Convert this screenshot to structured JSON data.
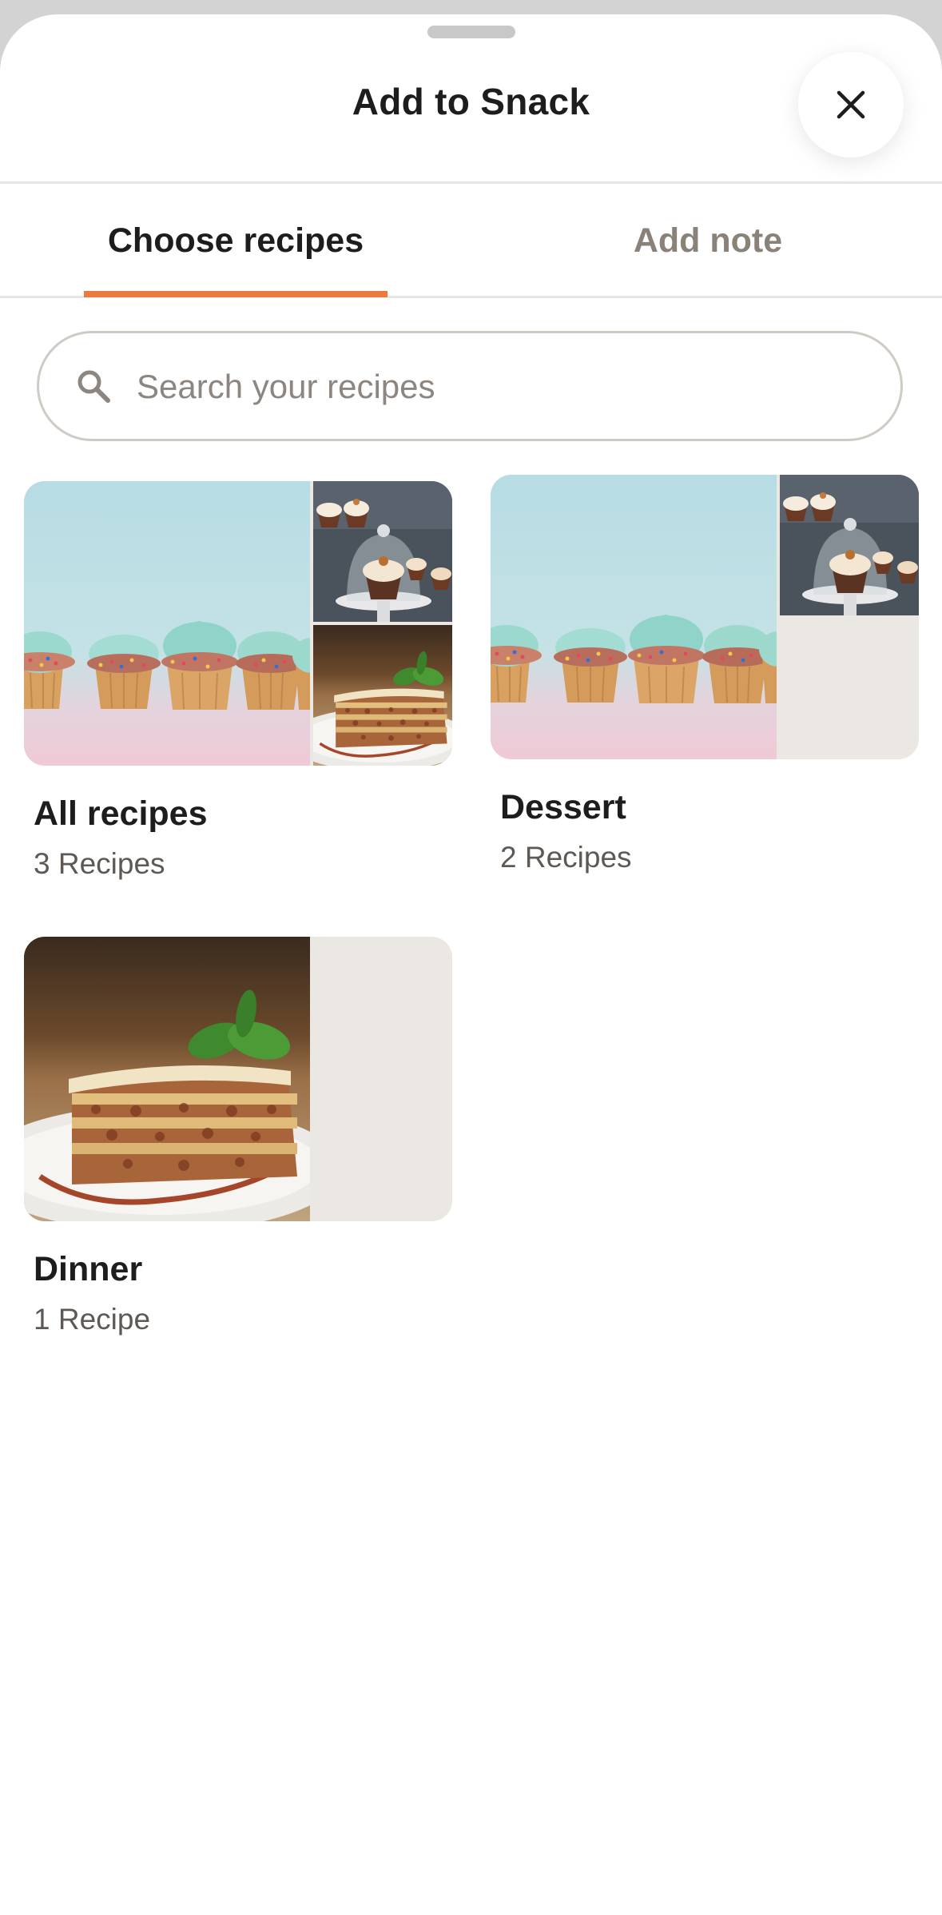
{
  "sheet": {
    "title": "Add to Snack",
    "close_icon": "close-icon"
  },
  "tabs": [
    {
      "label": "Choose recipes",
      "active": true
    },
    {
      "label": "Add note",
      "active": false
    }
  ],
  "colors": {
    "accent": "#ea7a3d",
    "text_primary": "#1d1d1d",
    "text_muted": "#8a8178",
    "placeholder_tile": "#ebe8e3"
  },
  "search": {
    "placeholder": "Search your recipes",
    "value": "",
    "icon": "search-icon"
  },
  "collections": [
    {
      "name": "All recipes",
      "count_label": "3 Recipes",
      "images": [
        "cupcakes-photo",
        "cupcake-dome-photo",
        "lasagna-photo"
      ]
    },
    {
      "name": "Dessert",
      "count_label": "2 Recipes",
      "images": [
        "cupcakes-photo",
        "cupcake-dome-photo"
      ]
    },
    {
      "name": "Dinner",
      "count_label": "1 Recipe",
      "images": [
        "lasagna-photo"
      ]
    }
  ]
}
